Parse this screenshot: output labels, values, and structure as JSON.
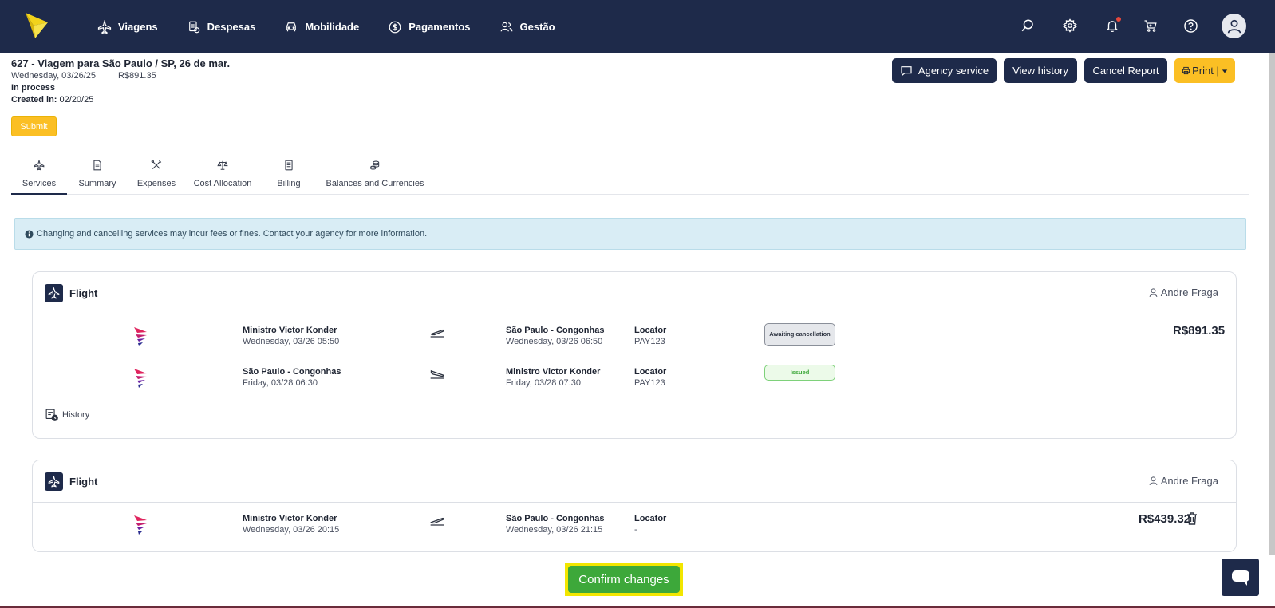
{
  "nav": {
    "items": [
      {
        "label": "Viagens",
        "icon": "plane-icon"
      },
      {
        "label": "Despesas",
        "icon": "receipt-icon"
      },
      {
        "label": "Mobilidade",
        "icon": "car-icon"
      },
      {
        "label": "Pagamentos",
        "icon": "dollar-circle-icon"
      },
      {
        "label": "Gestão",
        "icon": "users-icon"
      }
    ]
  },
  "report": {
    "title": "627 - Viagem para São Paulo / SP, 26 de mar.",
    "date": "Wednesday, 03/26/25",
    "amount": "R$891.35",
    "status": "In process",
    "created_label": "Created in:",
    "created_value": " 02/20/25",
    "submit_label": "Submit"
  },
  "actions": {
    "agency_service": "Agency service",
    "view_history": "View history",
    "cancel_report": "Cancel Report",
    "print": "Print |"
  },
  "tabs": [
    {
      "label": "Services",
      "icon": "plane-icon"
    },
    {
      "label": "Summary",
      "icon": "document-icon"
    },
    {
      "label": "Expenses",
      "icon": "tools-icon"
    },
    {
      "label": "Cost Allocation",
      "icon": "scale-icon"
    },
    {
      "label": "Billing",
      "icon": "invoice-icon"
    },
    {
      "label": "Balances and Currencies",
      "icon": "coins-icon"
    }
  ],
  "alert": {
    "text": "Changing and cancelling services may incur fees or fines. Contact your agency for more information."
  },
  "cards": [
    {
      "title": "Flight",
      "traveler": "Andre Fraga",
      "segments": [
        {
          "origin": "Ministro Victor Konder",
          "departure": "Wednesday, 03/26 05:50",
          "destination": "São Paulo - Congonhas",
          "arrival": "Wednesday, 03/26 06:50",
          "locator_label": "Locator",
          "locator": "PAY123",
          "status": "Awaiting cancellation"
        },
        {
          "origin": "São Paulo - Congonhas",
          "departure": "Friday, 03/28 06:30",
          "destination": "Ministro Victor Konder",
          "arrival": "Friday, 03/28 07:30",
          "locator_label": "Locator",
          "locator": "PAY123",
          "status": "Issued"
        }
      ],
      "price": "R$891.35",
      "history_label": "History"
    },
    {
      "title": "Flight",
      "traveler": "Andre Fraga",
      "segments": [
        {
          "origin": "Ministro Victor Konder",
          "departure": "Wednesday, 03/26 20:15",
          "destination": "São Paulo - Congonhas",
          "arrival": "Wednesday, 03/26 21:15",
          "locator_label": "Locator",
          "locator": "-"
        }
      ],
      "price": "R$439.32"
    }
  ],
  "confirm_label": "Confirm changes",
  "colors": {
    "navy": "#1e2a4a",
    "yellow": "#fbbf24",
    "green": "#3da83a",
    "highlight": "#f2e600"
  }
}
